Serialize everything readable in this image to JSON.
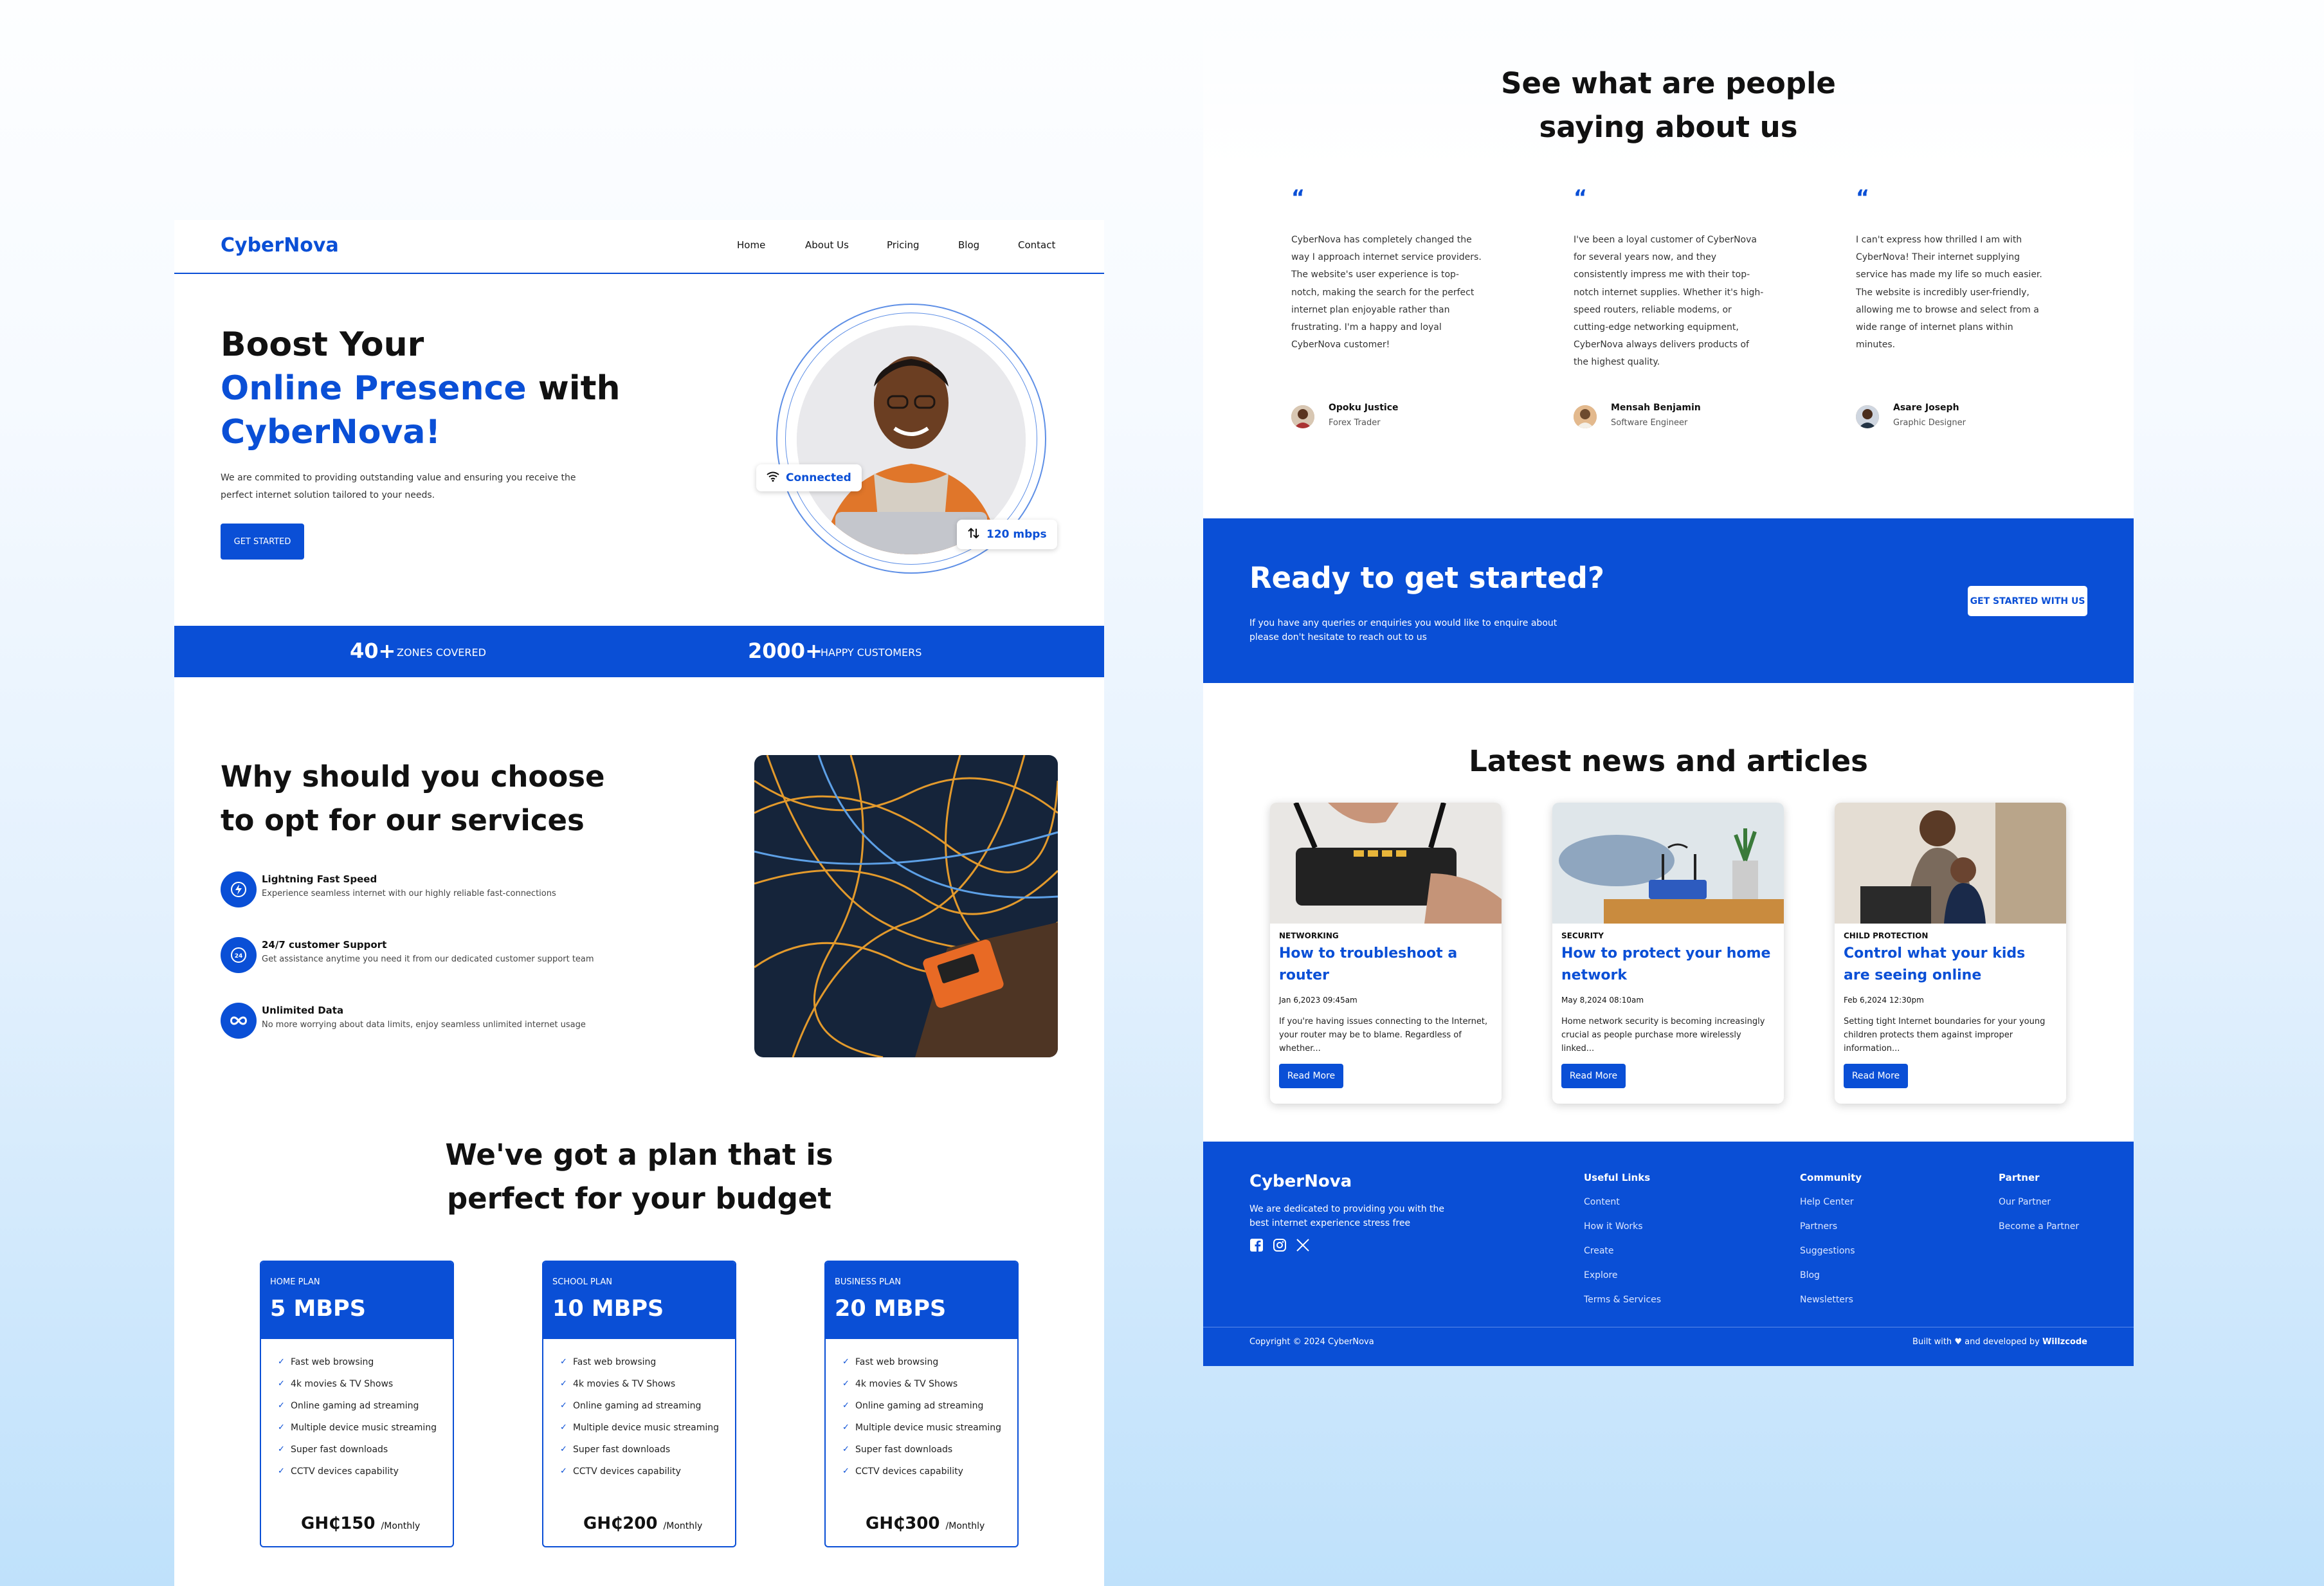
{
  "left": {
    "logo": "CyberNova",
    "nav": [
      "Home",
      "About Us",
      "Pricing",
      "Blog",
      "Contact"
    ],
    "hero": {
      "line1": "Boost Your",
      "line2_blue": "Online Presence",
      "line2_black": " with",
      "line3_blue": "CyberNova!",
      "subtitle": "We are commited to providing outstanding value and ensuring you receive the perfect internet solution tailored to your needs.",
      "cta": "GET STARTED",
      "badge_connected": "Connected",
      "badge_speed": "120 mbps"
    },
    "stats": [
      {
        "number": "40+",
        "label": "ZONES COVERED"
      },
      {
        "number": "2000+",
        "label": "HAPPY CUSTOMERS"
      }
    ],
    "why": {
      "title": "Why should you choose to opt for our services",
      "features": [
        {
          "title": "Lightning Fast Speed",
          "desc": "Experience seamless internet with our highly reliable fast-connections",
          "icon": "lightning-icon"
        },
        {
          "title": "24/7 customer Support",
          "desc": "Get assistance anytime you need it from our dedicated customer support team",
          "icon": "support-icon"
        },
        {
          "title": "Unlimited Data",
          "desc": "No more worrying about data limits, enjoy seamless unlimited internet usage",
          "icon": "infinity-icon"
        }
      ]
    },
    "plans_title": "We've got a plan that is perfect for your budget",
    "plans": [
      {
        "name": "HOME PLAN",
        "speed": "5 MBPS",
        "price": "GH₵150",
        "period": "/Monthly",
        "features": [
          "Fast web browsing",
          "4k movies & TV Shows",
          "Online gaming ad streaming",
          "Multiple device music streaming",
          "Super fast downloads",
          "CCTV devices capability"
        ]
      },
      {
        "name": "SCHOOL PLAN",
        "speed": "10 MBPS",
        "price": "GH₵200",
        "period": "/Monthly",
        "features": [
          "Fast web browsing",
          "4k movies & TV Shows",
          "Online gaming ad streaming",
          "Multiple device music streaming",
          "Super fast downloads",
          "CCTV devices capability"
        ]
      },
      {
        "name": "BUSINESS PLAN",
        "speed": "20 MBPS",
        "price": "GH₵300",
        "period": "/Monthly",
        "features": [
          "Fast web browsing",
          "4k movies & TV Shows",
          "Online gaming ad streaming",
          "Multiple device music streaming",
          "Super fast downloads",
          "CCTV devices capability"
        ]
      }
    ]
  },
  "right": {
    "testimonials_title": "See what are people saying about us",
    "testimonials": [
      {
        "text": "CyberNova has completely changed the way I approach internet service providers. The website's user experience is top-notch, making the search for the perfect internet plan enjoyable rather than frustrating. I'm a happy and loyal CyberNova customer!",
        "name": "Opoku Justice",
        "role": "Forex Trader"
      },
      {
        "text": "I've been a loyal customer of CyberNova for several years now, and they consistently impress me with their top-notch internet supplies. Whether it's high-speed routers, reliable modems, or cutting-edge networking equipment, CyberNova always delivers products of the highest quality.",
        "name": "Mensah Benjamin",
        "role": "Software Engineer"
      },
      {
        "text": "I can't express how thrilled I am with CyberNova! Their internet supplying service has made my life so much easier. The website is incredibly user-friendly, allowing me to browse and select from a wide range of internet plans within minutes.",
        "name": "Asare Joseph",
        "role": "Graphic Designer"
      }
    ],
    "cta": {
      "title": "Ready to get started?",
      "text": "If you have any queries or enquiries you would like to enquire about please don't hesitate to reach out to us",
      "button": "GET STARTED WITH US"
    },
    "news_title": "Latest news and articles",
    "news": [
      {
        "category": "NETWORKING",
        "title": "How to troubleshoot a router",
        "date": "Jan 6,2023 09:45am",
        "desc": "If you're having issues connecting to the Internet, your router may be to blame. Regardless of whether...",
        "button": "Read More"
      },
      {
        "category": "SECURITY",
        "title": "How to protect your home network",
        "date": "May 8,2024 08:10am",
        "desc": "Home network security is becoming increasingly crucial as people purchase more wirelessly linked...",
        "button": "Read More"
      },
      {
        "category": "CHILD PROTECTION",
        "title": "Control what your kids are seeing online",
        "date": "Feb 6,2024 12:30pm",
        "desc": "Setting tight Internet boundaries for your young children protects them against improper information...",
        "button": "Read More"
      }
    ],
    "footer": {
      "logo": "CyberNova",
      "tagline": "We are dedicated to providing you with the best internet experience stress free",
      "columns": [
        {
          "heading": "Useful Links",
          "links": [
            "Content",
            "How it Works",
            "Create",
            "Explore",
            "Terms & Services"
          ]
        },
        {
          "heading": "Community",
          "links": [
            "Help Center",
            "Partners",
            "Suggestions",
            "Blog",
            "Newsletters"
          ]
        },
        {
          "heading": "Partner",
          "links": [
            "Our Partner",
            "Become a Partner"
          ]
        }
      ],
      "copyright": "Copyright © 2024 CyberNova",
      "built_prefix": "Built with",
      "built_suffix": "and developed by",
      "built_by": "Willzcode"
    }
  },
  "colors": {
    "brand": "#0a4fd6",
    "text": "#111111",
    "white": "#ffffff"
  }
}
